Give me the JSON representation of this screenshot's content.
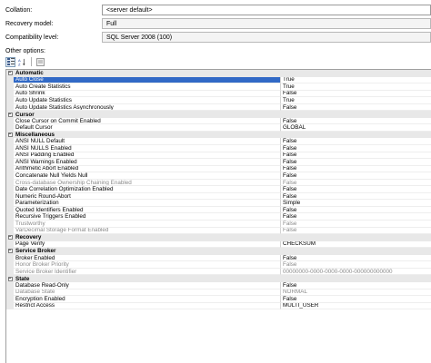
{
  "fields": {
    "collation": {
      "label": "Collation:",
      "value": "<server default>"
    },
    "recovery_model": {
      "label": "Recovery model:",
      "value": "Full"
    },
    "compatibility": {
      "label": "Compatibility level:",
      "value": "SQL Server 2008 (100)"
    }
  },
  "other_options_label": "Other options:",
  "toolbar": {
    "icons": [
      "categorized-icon",
      "alphabetical-icon",
      "property-pages-icon"
    ]
  },
  "grid": {
    "categories": [
      {
        "name": "Automatic",
        "expander": "−",
        "properties": [
          {
            "name": "Auto Close",
            "value": "True",
            "selected": true
          },
          {
            "name": "Auto Create Statistics",
            "value": "True"
          },
          {
            "name": "Auto Shrink",
            "value": "False"
          },
          {
            "name": "Auto Update Statistics",
            "value": "True"
          },
          {
            "name": "Auto Update Statistics Asynchronously",
            "value": "False"
          }
        ]
      },
      {
        "name": "Cursor",
        "expander": "−",
        "properties": [
          {
            "name": "Close Cursor on Commit Enabled",
            "value": "False"
          },
          {
            "name": "Default Cursor",
            "value": "GLOBAL"
          }
        ]
      },
      {
        "name": "Miscellaneous",
        "expander": "−",
        "properties": [
          {
            "name": "ANSI NULL Default",
            "value": "False"
          },
          {
            "name": "ANSI NULLS Enabled",
            "value": "False"
          },
          {
            "name": "ANSI Padding Enabled",
            "value": "False"
          },
          {
            "name": "ANSI Warnings Enabled",
            "value": "False"
          },
          {
            "name": "Arithmetic Abort Enabled",
            "value": "False"
          },
          {
            "name": "Concatenate Null Yields Null",
            "value": "False"
          },
          {
            "name": "Cross-database Ownership Chaining Enabled",
            "value": "False",
            "disabled": true
          },
          {
            "name": "Date Correlation Optimization Enabled",
            "value": "False"
          },
          {
            "name": "Numeric Round-Abort",
            "value": "False"
          },
          {
            "name": "Parameterization",
            "value": "Simple"
          },
          {
            "name": "Quoted Identifiers Enabled",
            "value": "False"
          },
          {
            "name": "Recursive Triggers Enabled",
            "value": "False"
          },
          {
            "name": "Trustworthy",
            "value": "False",
            "disabled": true
          },
          {
            "name": "VarDecimal Storage Format Enabled",
            "value": "False",
            "disabled": true
          }
        ]
      },
      {
        "name": "Recovery",
        "expander": "−",
        "properties": [
          {
            "name": "Page Verify",
            "value": "CHECKSUM"
          }
        ]
      },
      {
        "name": "Service Broker",
        "expander": "−",
        "properties": [
          {
            "name": "Broker Enabled",
            "value": "False"
          },
          {
            "name": "Honor Broker Priority",
            "value": "False",
            "disabled": true
          },
          {
            "name": "Service Broker Identifier",
            "value": "00000000-0000-0000-0000-000000000000",
            "disabled": true
          }
        ]
      },
      {
        "name": "State",
        "expander": "−",
        "properties": [
          {
            "name": "Database Read-Only",
            "value": "False"
          },
          {
            "name": "Database State",
            "value": "NORMAL",
            "disabled": true
          },
          {
            "name": "Encryption Enabled",
            "value": "False"
          },
          {
            "name": "Restrict Access",
            "value": "MULTI_USER"
          }
        ]
      }
    ]
  }
}
